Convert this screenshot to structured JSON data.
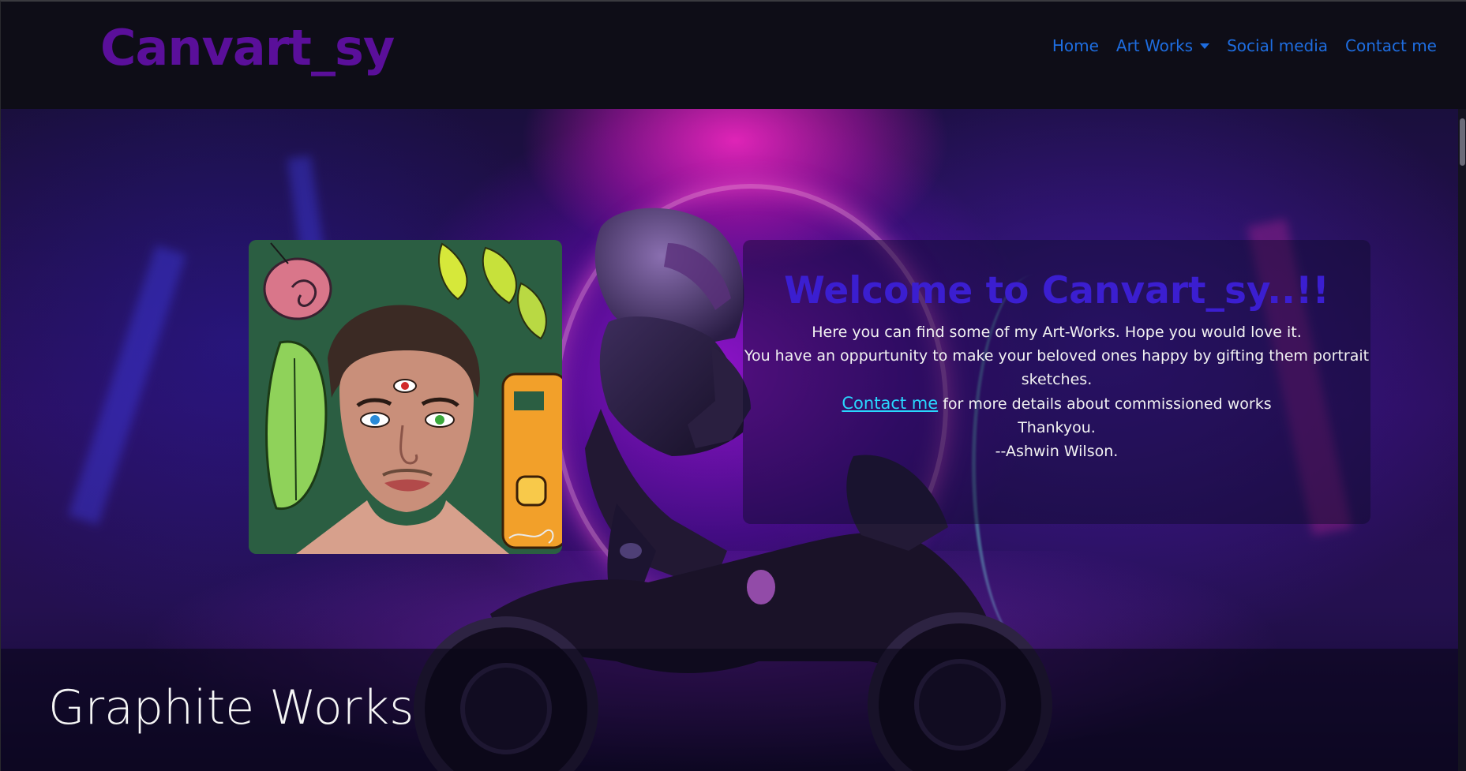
{
  "navbar": {
    "brand": "Canvart_sy",
    "links": {
      "home": "Home",
      "art_works": "Art Works",
      "social_media": "Social media",
      "contact_me": "Contact me"
    },
    "link_color": "#1e6de0",
    "brand_color": "#5a0f9a"
  },
  "welcome": {
    "heading": "Welcome to Canvart_sy..!!",
    "line1": "Here you can find some of my Art-Works. Hope you would love it.",
    "line2": "You have an oppurtunity to make your beloved ones happy by gifting them portrait sketches.",
    "contact_link": "Contact me",
    "contact_suffix": " for more details about commissioned works",
    "thanks": "Thankyou.",
    "signature": "--Ashwin Wilson.",
    "heading_color": "#3b1ed0",
    "link_color": "#29d7ff"
  },
  "portrait": {
    "description_icon": "self-portrait-illustration"
  },
  "sections": {
    "graphite_title": "Graphite Works"
  }
}
